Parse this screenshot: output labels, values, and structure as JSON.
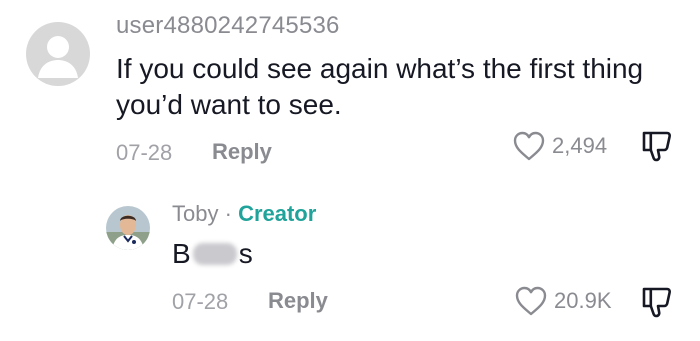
{
  "comment": {
    "username": "user4880242745536",
    "text": "If you could see again what’s the first thing you’d want to see.",
    "date": "07-28",
    "reply_label": "Reply",
    "likes": "2,494"
  },
  "reply": {
    "name": "Toby",
    "separator": "·",
    "creator_label": "Creator",
    "text_start": "B",
    "text_end": "s",
    "date": "07-28",
    "reply_label": "Reply",
    "likes": "20.9K"
  },
  "colors": {
    "creator": "#20a39a",
    "muted": "#8a8b91",
    "text": "#161823"
  },
  "icons": [
    "heart-icon",
    "dislike-icon",
    "default-avatar"
  ]
}
